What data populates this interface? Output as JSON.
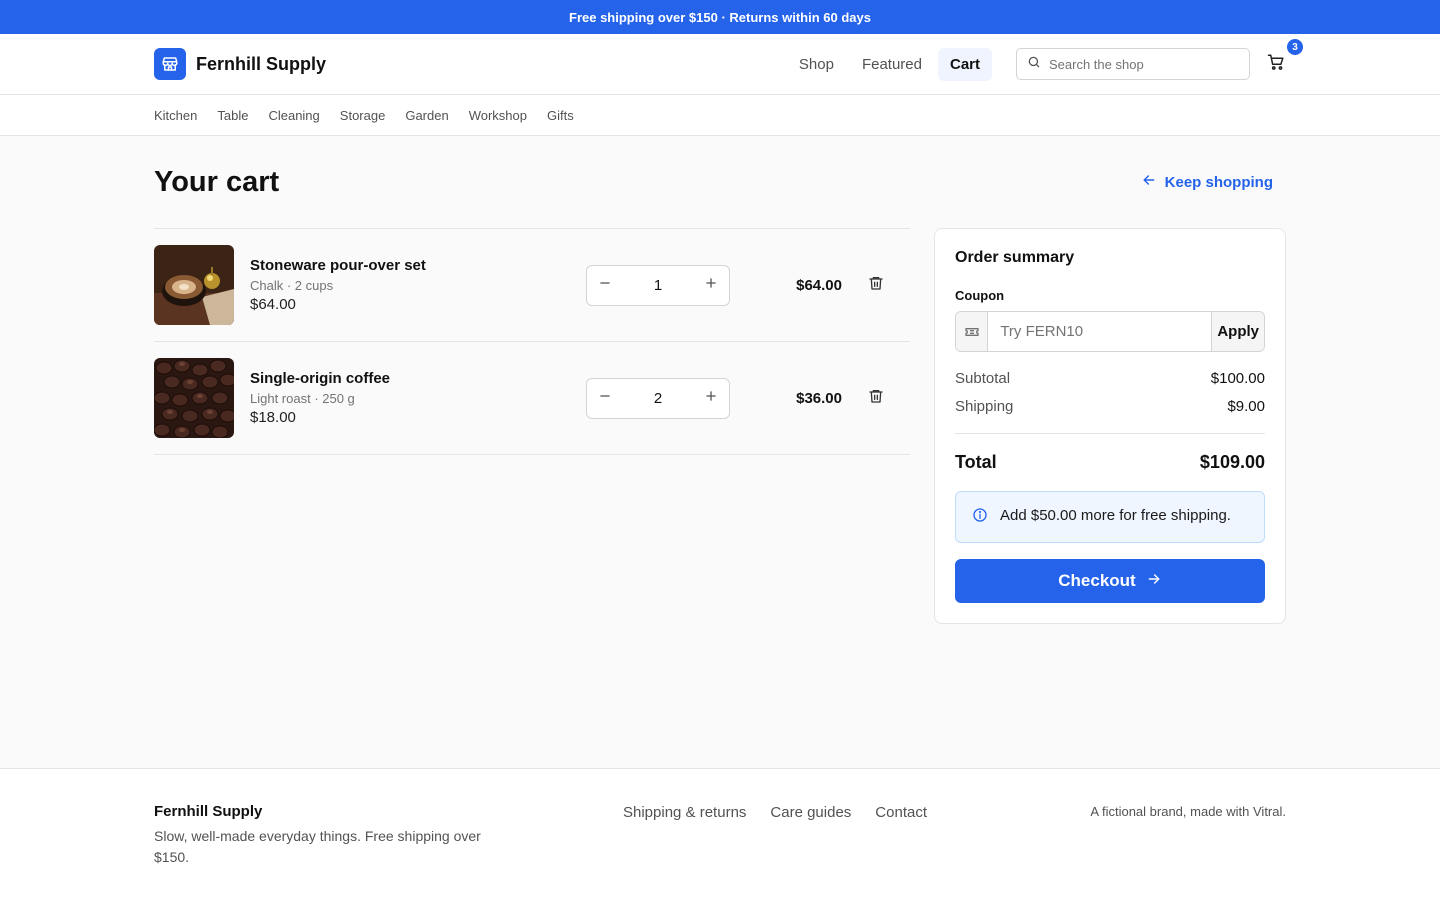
{
  "promo": "Free shipping over $150 · Returns within 60 days",
  "brand": {
    "name": "Fernhill Supply"
  },
  "mainnav": [
    "Shop",
    "Featured",
    "Cart"
  ],
  "search": {
    "placeholder": "Search the shop"
  },
  "cart": {
    "count": "3"
  },
  "categories": [
    "Kitchen",
    "Table",
    "Cleaning",
    "Storage",
    "Garden",
    "Workshop",
    "Gifts"
  ],
  "page": {
    "title": "Your cart",
    "keep_shopping": "Keep shopping"
  },
  "items": [
    {
      "name": "Stoneware pour-over set",
      "variant": "Chalk · 2 cups",
      "price": "$64.00",
      "qty": "1",
      "total": "$64.00"
    },
    {
      "name": "Single-origin coffee",
      "variant": "Light roast · 250 g",
      "price": "$18.00",
      "qty": "2",
      "total": "$36.00"
    }
  ],
  "summary": {
    "title": "Order summary",
    "coupon_label": "Coupon",
    "coupon_placeholder": "Try FERN10",
    "apply": "Apply",
    "subtotal_label": "Subtotal",
    "subtotal": "$100.00",
    "shipping_label": "Shipping",
    "shipping": "$9.00",
    "total_label": "Total",
    "total": "$109.00",
    "notice": "Add $50.00 more for free shipping.",
    "checkout": "Checkout"
  },
  "footer": {
    "brand": "Fernhill Supply",
    "tagline": "Slow, well-made everyday things. Free shipping over $150.",
    "links": [
      "Shipping & returns",
      "Care guides",
      "Contact"
    ],
    "note": "A fictional brand, made with Vitral."
  },
  "colors": {
    "accent": "#2563eb",
    "notice_bg": "#eff6ff"
  }
}
